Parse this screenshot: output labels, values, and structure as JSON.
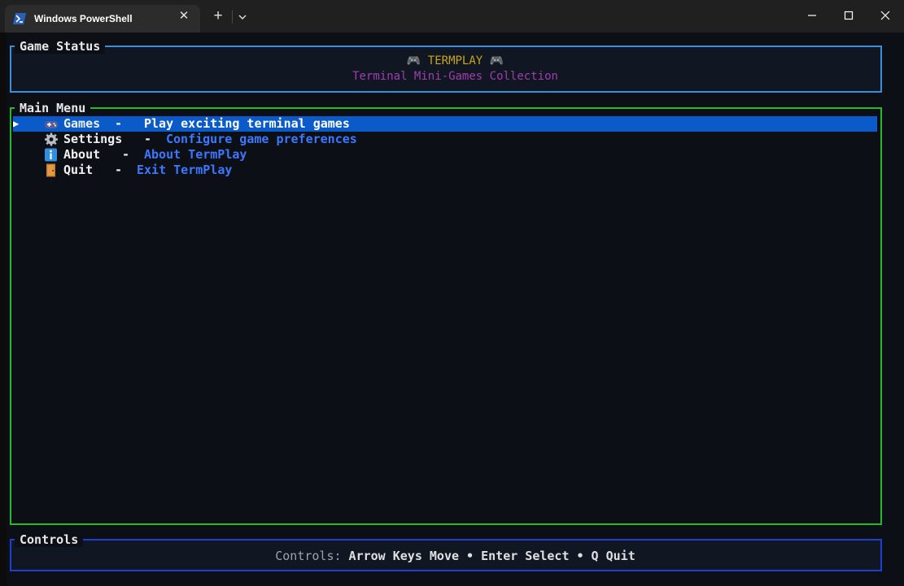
{
  "window": {
    "tab_title": "Windows PowerShell",
    "tab_icon": "powershell-icon",
    "close_tab_glyph": "✕",
    "new_tab_glyph": "+",
    "controls": [
      "minimize-icon",
      "maximize-icon",
      "close-icon"
    ]
  },
  "status": {
    "title": "Game Status",
    "app_name": "🎮 TERMPLAY 🎮",
    "subtitle": "Terminal Mini-Games Collection",
    "colors": {
      "border": "#3a8fd6",
      "app_name": "#c8a417",
      "subtitle": "#a13dad"
    }
  },
  "menu": {
    "title": "Main Menu",
    "cursor": "▶",
    "border_color": "#27b830",
    "items": [
      {
        "icon": "gamepad-icon",
        "label": "Games",
        "sep": "-",
        "description": "Play exciting terminal games",
        "selected": true
      },
      {
        "icon": "gear-icon",
        "label": "Settings",
        "sep": "-",
        "description": "Configure game preferences",
        "selected": false
      },
      {
        "icon": "info-icon",
        "label": "About",
        "sep": "-",
        "description": "About TermPlay",
        "selected": false
      },
      {
        "icon": "door-icon",
        "label": "Quit",
        "sep": "-",
        "description": "Exit TermPlay",
        "selected": false
      }
    ],
    "colors": {
      "selection": "#0a5ac9",
      "description": "#3b78ff"
    }
  },
  "controls_panel": {
    "title": "Controls",
    "label": "Controls:",
    "text": "Arrow Keys Move • Enter Select • Q Quit",
    "border_color": "#1e3fd0"
  }
}
